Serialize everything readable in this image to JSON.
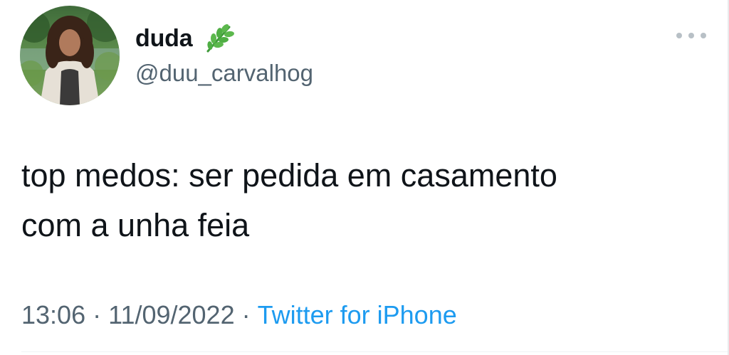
{
  "author": {
    "display_name": "duda",
    "handle": "@duu_carvalhog",
    "badge_icon": "herb-leaf-icon",
    "avatar_icon": "profile-photo"
  },
  "menu": {
    "icon": "more-options-icon"
  },
  "tweet": {
    "text_lines": [
      "top medos: ser pedida em casamento",
      "com a unha feia"
    ]
  },
  "meta": {
    "time": "13:06",
    "separator": "·",
    "date": "11/09/2022",
    "source": "Twitter for iPhone"
  },
  "colors": {
    "text": "#0f1419",
    "secondary": "#536471",
    "link": "#1d9bf0",
    "leaf": "#4caf50"
  }
}
